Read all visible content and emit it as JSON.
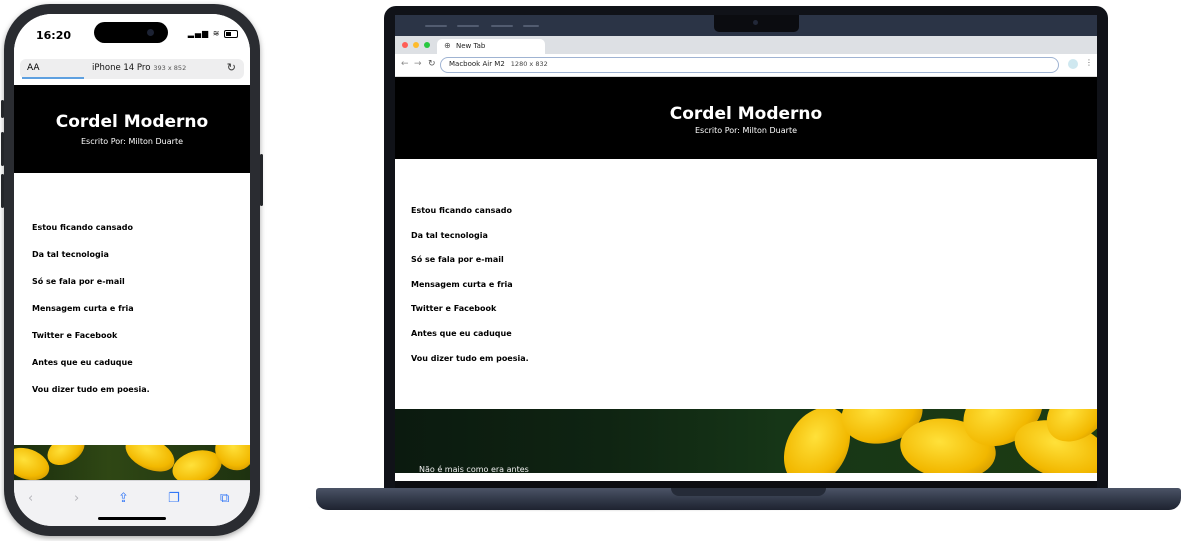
{
  "phone": {
    "status_time": "16:20",
    "text_size_button": "AA",
    "device_label": "iPhone 14 Pro",
    "device_size": "393 x 852",
    "reload_icon": "reload-icon",
    "toolbar_icons": [
      "back-arrow-icon",
      "forward-arrow-icon",
      "share-icon",
      "bookmarks-icon",
      "tabs-icon"
    ]
  },
  "laptop": {
    "tab_title": "New Tab",
    "omnibox_device": "Macbook Air M2",
    "omnibox_size": "1280 x 832",
    "traffic_lights": [
      "#ff5f57",
      "#febc2e",
      "#28c840"
    ],
    "flower_caption": "Não é mais como era antes"
  },
  "site": {
    "title": "Cordel Moderno",
    "subtitle": "Escrito Por: Milton Duarte",
    "poem_lines": [
      "Estou ficando cansado",
      "Da tal tecnologia",
      "Só se fala por e-mail",
      "Mensagem curta e fria",
      "Twitter e Facebook",
      "Antes que eu caduque",
      "Vou dizer tudo em poesia."
    ]
  }
}
